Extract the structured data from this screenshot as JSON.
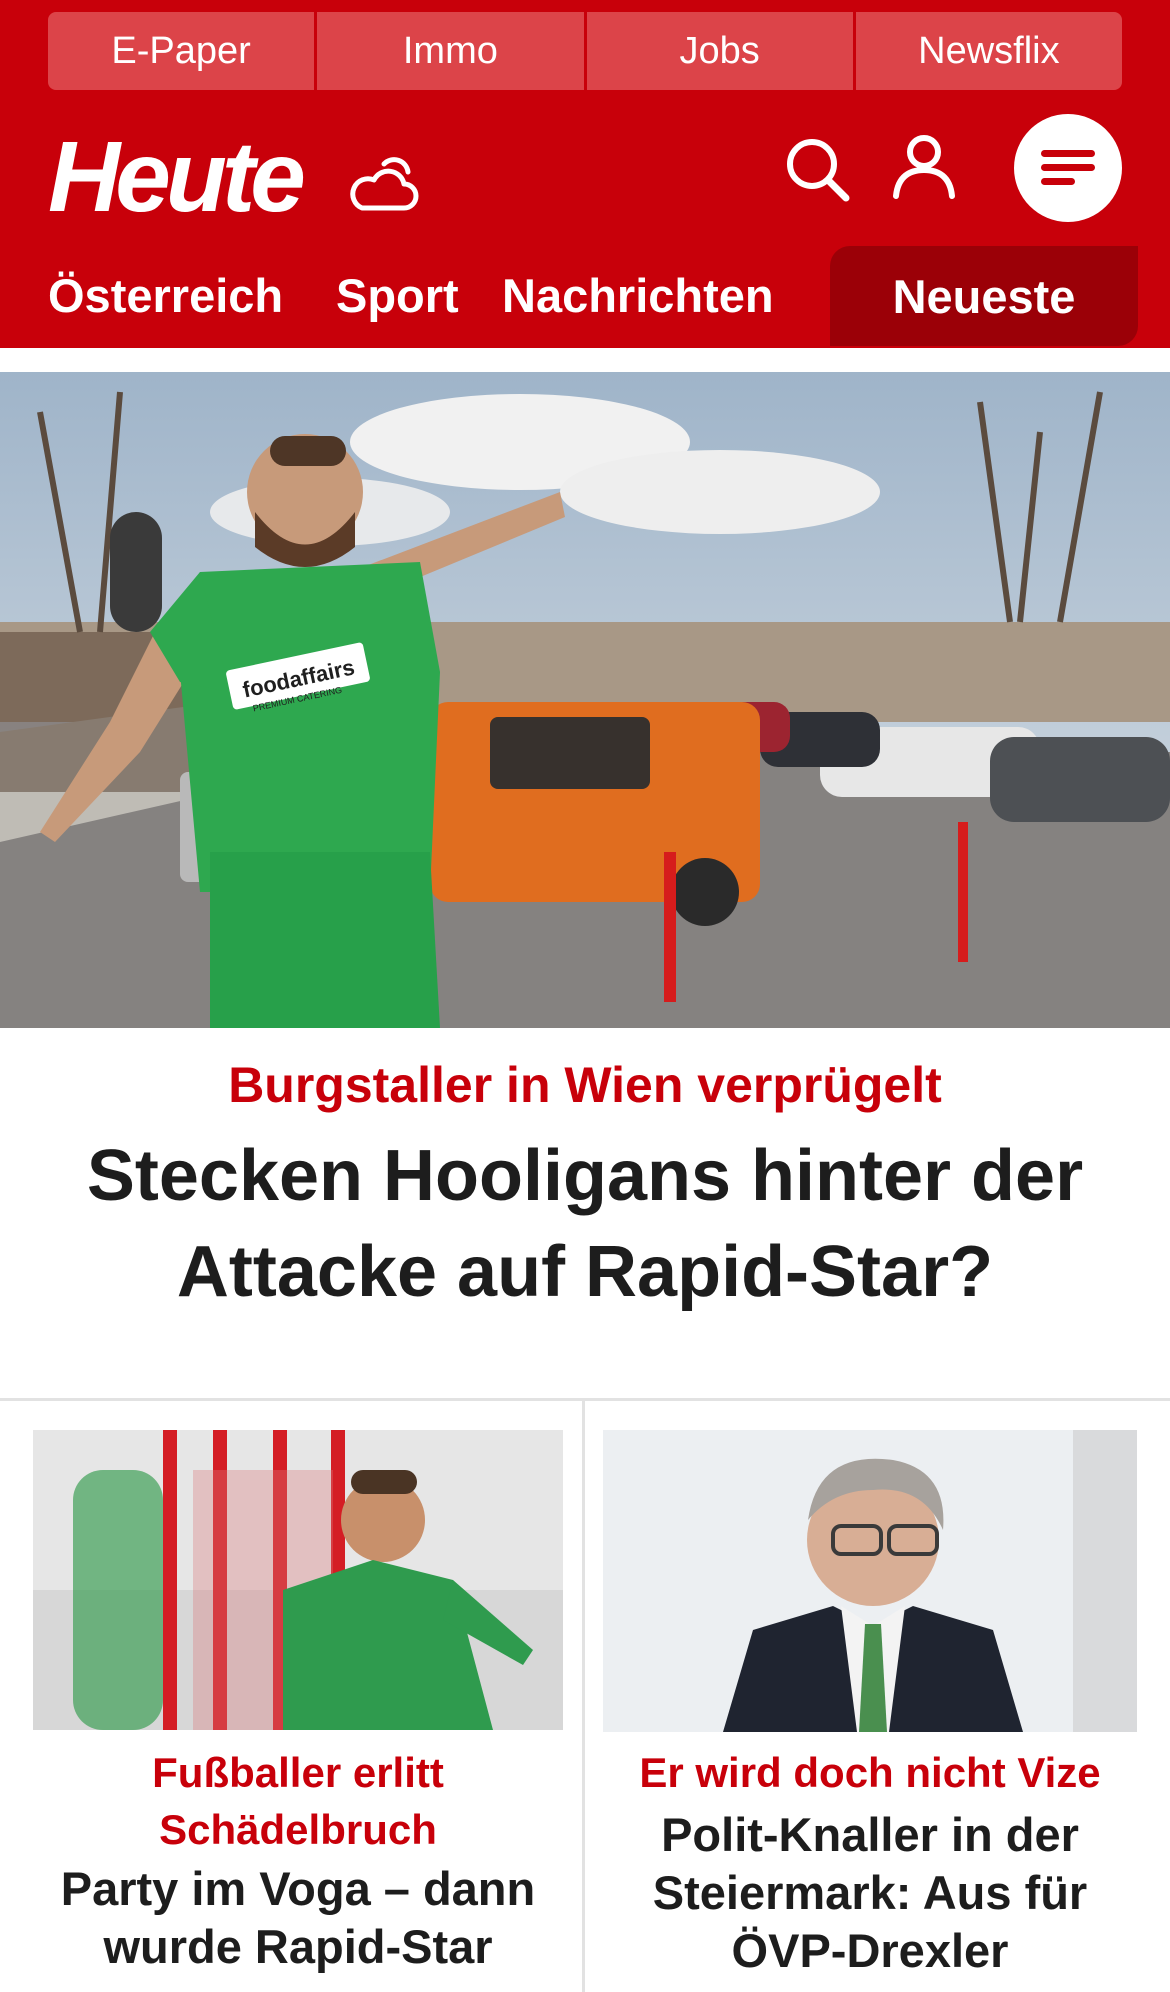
{
  "top_links": [
    "E-Paper",
    "Immo",
    "Jobs",
    "Newsflix"
  ],
  "brand": {
    "logo_text": "Heute",
    "primary_color": "#c8000a",
    "dark_red": "#9b0007"
  },
  "icons": [
    "cloud-sun-icon",
    "search-icon",
    "user-icon",
    "menu-icon"
  ],
  "nav": {
    "items": [
      "Österreich",
      "Sport",
      "Nachrichten"
    ],
    "active": "Neueste"
  },
  "hero": {
    "image_text": {
      "shirt_sponsor": "foodaffairs",
      "shirt_sponsor_sub": "PREMIUM CATERING"
    },
    "kicker": "Burgstaller in Wien verprügelt",
    "title": "Stecken Hooligans hinter der Attacke auf Rapid-Star?"
  },
  "cards": [
    {
      "kicker": "Fußballer erlitt Schädelbruch",
      "title": "Party im Voga – dann wurde Rapid-Star"
    },
    {
      "kicker": "Er wird doch nicht Vize",
      "title": "Polit-Knaller in der Steiermark: Aus für ÖVP-Drexler"
    }
  ]
}
